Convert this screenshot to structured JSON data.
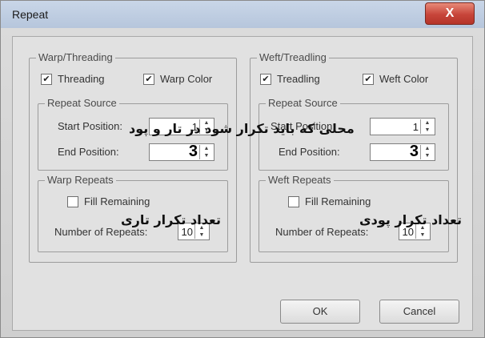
{
  "window": {
    "title": "Repeat",
    "close_label": "X"
  },
  "warp": {
    "group_label": "Warp/Threading",
    "threading_label": "Threading",
    "warp_color_label": "Warp Color",
    "source_label": "Repeat Source",
    "start_label": "Start Position:",
    "start_value": "1",
    "end_label": "End Position:",
    "end_value": "3",
    "repeats_label": "Warp Repeats",
    "fill_label": "Fill Remaining",
    "number_label": "Number of Repeats:",
    "number_value": "10"
  },
  "weft": {
    "group_label": "Weft/Treadling",
    "treadling_label": "Treadling",
    "weft_color_label": "Weft Color",
    "source_label": "Repeat Source",
    "start_label": "Start Position:",
    "start_value": "1",
    "end_label": "End Position:",
    "end_value": "3",
    "repeats_label": "Weft Repeats",
    "fill_label": "Fill Remaining",
    "number_label": "Number of Repeats:",
    "number_value": "10"
  },
  "buttons": {
    "ok": "OK",
    "cancel": "Cancel"
  },
  "annotations": {
    "repeat_location": "محلی که باید تکرار شود در تار و پود",
    "warp_repeat_count": "تعداد تکرار تاری",
    "weft_repeat_count": "تعداد تکرار پودی"
  },
  "checkbox_states": {
    "threading": true,
    "warp_color": true,
    "treadling": true,
    "weft_color": true,
    "warp_fill": false,
    "weft_fill": false
  },
  "colors": {
    "close_button": "#c7453a",
    "titlebar": "#b6c6dc"
  }
}
